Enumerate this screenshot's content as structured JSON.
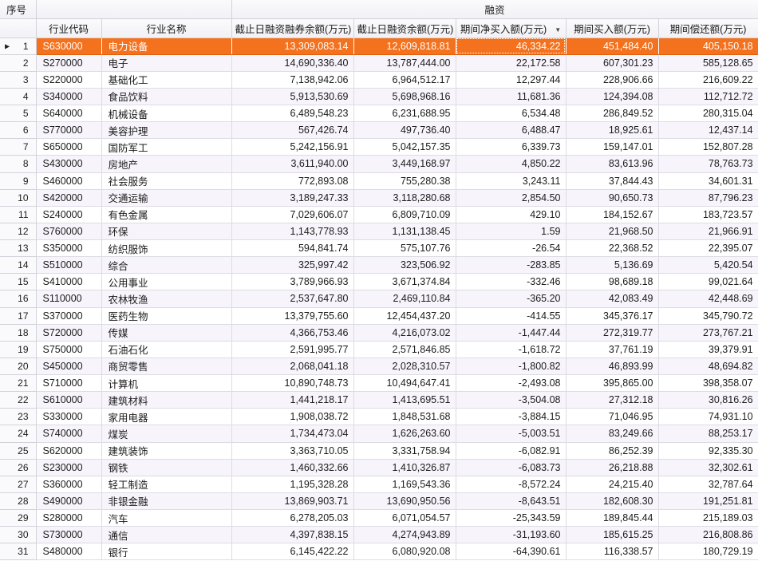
{
  "colors": {
    "selected_row_bg": "#F4711D",
    "selected_row_text": "#FFFFFF",
    "header_bg": "#F4F4F8",
    "grid_line": "#DCDCE4",
    "alt_row_bg": "#F7F5FB",
    "gutter_bg": "#FAFAFC"
  },
  "icons": {
    "sort_descending": "▼",
    "selected_row_indicator": "▶"
  },
  "table": {
    "group_header": "融资",
    "row_number_header": "序号",
    "columns": [
      "行业代码",
      "行业名称",
      "截止日融资融券余额(万元)",
      "截止日融资余额(万元)",
      "期间净买入额(万元)",
      "期间买入额(万元)",
      "期间偿还额(万元)"
    ],
    "sort": {
      "column": "期间净买入额(万元)",
      "direction": "descending"
    },
    "selected_row_index": 0,
    "focused_cell": {
      "row_index": 0,
      "column_index": 4
    },
    "rows": [
      [
        1,
        "S630000",
        "电力设备",
        "13,309,083.14",
        "12,609,818.81",
        "46,334.22",
        "451,484.40",
        "405,150.18"
      ],
      [
        2,
        "S270000",
        "电子",
        "14,690,336.40",
        "13,787,444.00",
        "22,172.58",
        "607,301.23",
        "585,128.65"
      ],
      [
        3,
        "S220000",
        "基础化工",
        "7,138,942.06",
        "6,964,512.17",
        "12,297.44",
        "228,906.66",
        "216,609.22"
      ],
      [
        4,
        "S340000",
        "食品饮料",
        "5,913,530.69",
        "5,698,968.16",
        "11,681.36",
        "124,394.08",
        "112,712.72"
      ],
      [
        5,
        "S640000",
        "机械设备",
        "6,489,548.23",
        "6,231,688.95",
        "6,534.48",
        "286,849.52",
        "280,315.04"
      ],
      [
        6,
        "S770000",
        "美容护理",
        "567,426.74",
        "497,736.40",
        "6,488.47",
        "18,925.61",
        "12,437.14"
      ],
      [
        7,
        "S650000",
        "国防军工",
        "5,242,156.91",
        "5,042,157.35",
        "6,339.73",
        "159,147.01",
        "152,807.28"
      ],
      [
        8,
        "S430000",
        "房地产",
        "3,611,940.00",
        "3,449,168.97",
        "4,850.22",
        "83,613.96",
        "78,763.73"
      ],
      [
        9,
        "S460000",
        "社会服务",
        "772,893.08",
        "755,280.38",
        "3,243.11",
        "37,844.43",
        "34,601.31"
      ],
      [
        10,
        "S420000",
        "交通运输",
        "3,189,247.33",
        "3,118,280.68",
        "2,854.50",
        "90,650.73",
        "87,796.23"
      ],
      [
        11,
        "S240000",
        "有色金属",
        "7,029,606.07",
        "6,809,710.09",
        "429.10",
        "184,152.67",
        "183,723.57"
      ],
      [
        12,
        "S760000",
        "环保",
        "1,143,778.93",
        "1,131,138.45",
        "1.59",
        "21,968.50",
        "21,966.91"
      ],
      [
        13,
        "S350000",
        "纺织服饰",
        "594,841.74",
        "575,107.76",
        "-26.54",
        "22,368.52",
        "22,395.07"
      ],
      [
        14,
        "S510000",
        "综合",
        "325,997.42",
        "323,506.92",
        "-283.85",
        "5,136.69",
        "5,420.54"
      ],
      [
        15,
        "S410000",
        "公用事业",
        "3,789,966.93",
        "3,671,374.84",
        "-332.46",
        "98,689.18",
        "99,021.64"
      ],
      [
        16,
        "S110000",
        "农林牧渔",
        "2,537,647.80",
        "2,469,110.84",
        "-365.20",
        "42,083.49",
        "42,448.69"
      ],
      [
        17,
        "S370000",
        "医药生物",
        "13,379,755.60",
        "12,454,437.20",
        "-414.55",
        "345,376.17",
        "345,790.72"
      ],
      [
        18,
        "S720000",
        "传媒",
        "4,366,753.46",
        "4,216,073.02",
        "-1,447.44",
        "272,319.77",
        "273,767.21"
      ],
      [
        19,
        "S750000",
        "石油石化",
        "2,591,995.77",
        "2,571,846.85",
        "-1,618.72",
        "37,761.19",
        "39,379.91"
      ],
      [
        20,
        "S450000",
        "商贸零售",
        "2,068,041.18",
        "2,028,310.57",
        "-1,800.82",
        "46,893.99",
        "48,694.82"
      ],
      [
        21,
        "S710000",
        "计算机",
        "10,890,748.73",
        "10,494,647.41",
        "-2,493.08",
        "395,865.00",
        "398,358.07"
      ],
      [
        22,
        "S610000",
        "建筑材料",
        "1,441,218.17",
        "1,413,695.51",
        "-3,504.08",
        "27,312.18",
        "30,816.26"
      ],
      [
        23,
        "S330000",
        "家用电器",
        "1,908,038.72",
        "1,848,531.68",
        "-3,884.15",
        "71,046.95",
        "74,931.10"
      ],
      [
        24,
        "S740000",
        "煤炭",
        "1,734,473.04",
        "1,626,263.60",
        "-5,003.51",
        "83,249.66",
        "88,253.17"
      ],
      [
        25,
        "S620000",
        "建筑装饰",
        "3,363,710.05",
        "3,331,758.94",
        "-6,082.91",
        "86,252.39",
        "92,335.30"
      ],
      [
        26,
        "S230000",
        "钢铁",
        "1,460,332.66",
        "1,410,326.87",
        "-6,083.73",
        "26,218.88",
        "32,302.61"
      ],
      [
        27,
        "S360000",
        "轻工制造",
        "1,195,328.28",
        "1,169,543.36",
        "-8,572.24",
        "24,215.40",
        "32,787.64"
      ],
      [
        28,
        "S490000",
        "非银金融",
        "13,869,903.71",
        "13,690,950.56",
        "-8,643.51",
        "182,608.30",
        "191,251.81"
      ],
      [
        29,
        "S280000",
        "汽车",
        "6,278,205.03",
        "6,071,054.57",
        "-25,343.59",
        "189,845.44",
        "215,189.03"
      ],
      [
        30,
        "S730000",
        "通信",
        "4,397,838.15",
        "4,274,943.89",
        "-31,193.60",
        "185,615.25",
        "216,808.86"
      ],
      [
        31,
        "S480000",
        "银行",
        "6,145,422.22",
        "6,080,920.08",
        "-64,390.61",
        "116,338.57",
        "180,729.19"
      ]
    ]
  }
}
